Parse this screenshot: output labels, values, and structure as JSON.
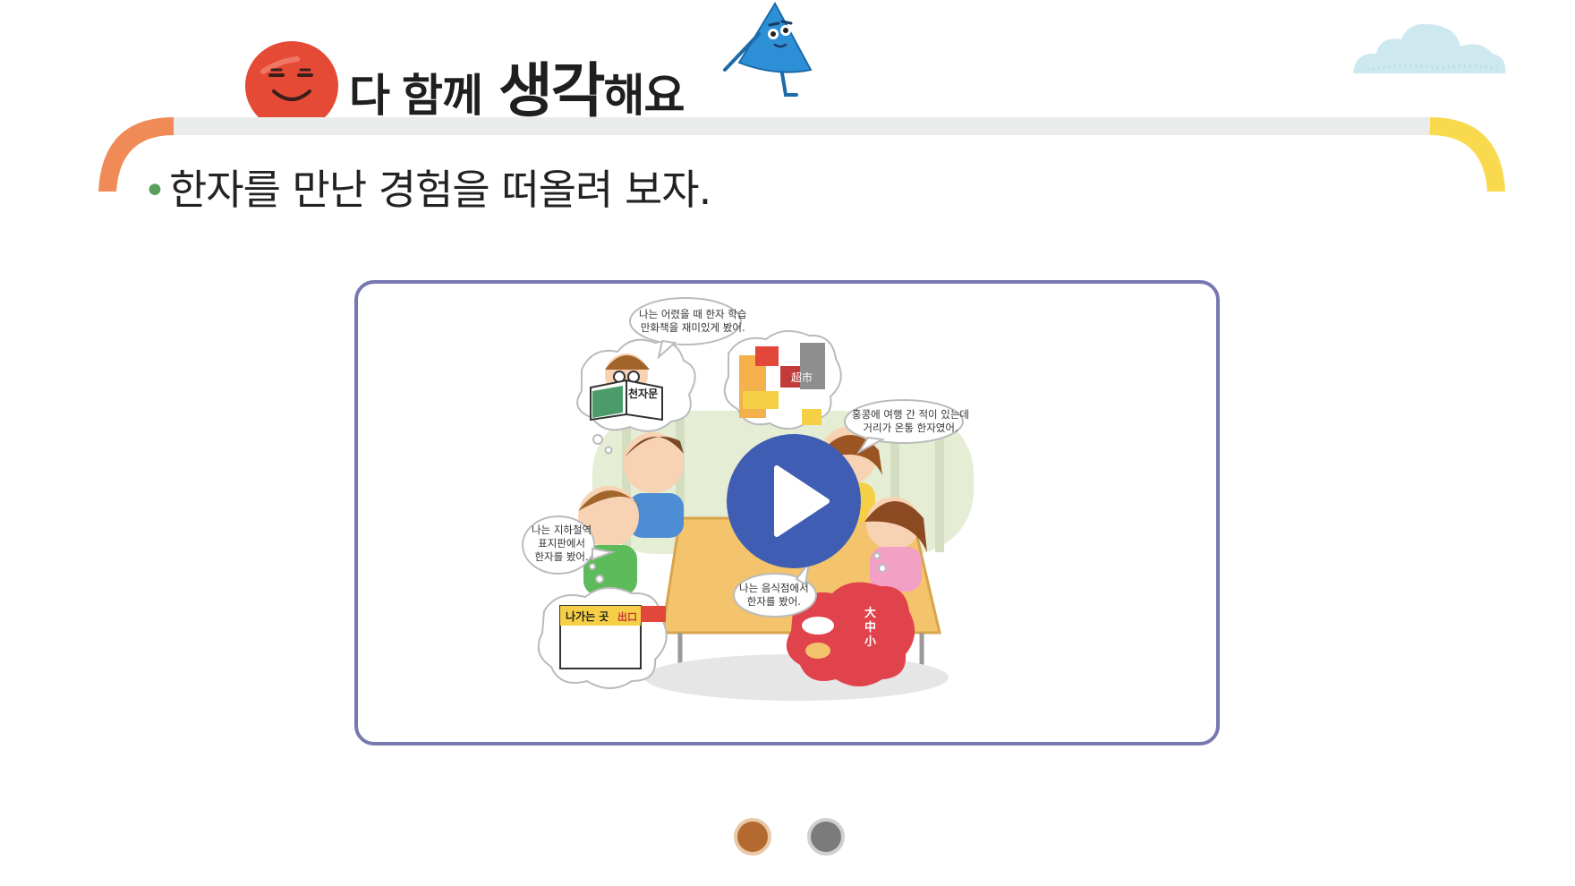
{
  "header": {
    "title_parts": [
      "다",
      "함께",
      "생각",
      "해요"
    ]
  },
  "prompt": {
    "bullet": "•",
    "text": "한자를 만난 경험을 떠올려 보자."
  },
  "video": {
    "bubbles": {
      "top": [
        "나는 어렸을 때 한자 학습",
        "만화책을 재미있게 봤어."
      ],
      "right": [
        "홍콩에 여행 간 적이 있는데",
        "거리가 온통 한자였어."
      ],
      "left": [
        "나는 지하철역",
        "표지판에서",
        "한자를 봤어."
      ],
      "bottom": [
        "나는 음식점에서",
        "한자를 봤어."
      ]
    },
    "book_label": "천자문",
    "sign_label": "나가는 곳",
    "sign_exit": "出口",
    "shop_sign": "超市",
    "menu_sizes": [
      "大",
      "中",
      "小"
    ]
  },
  "colors": {
    "arc_left": "#f08a57",
    "arc_right": "#f9d94e",
    "bar": "#e9ecea",
    "card_border": "#7878b0",
    "play": "#3f5eb3",
    "dot_active": "#b46a2e",
    "dot_inactive": "#7b7b7b"
  },
  "pagination": {
    "count": 2,
    "active": 1
  }
}
